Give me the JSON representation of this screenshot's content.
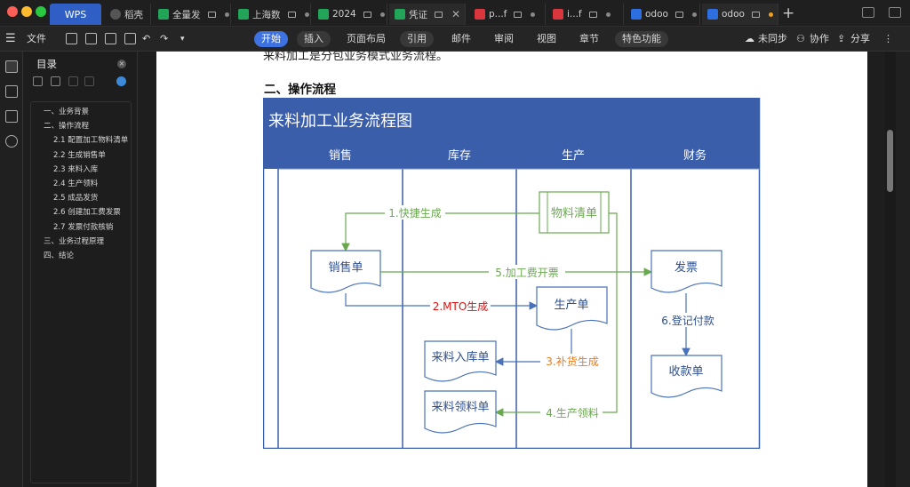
{
  "tabs": {
    "wps": "WPS",
    "items": [
      {
        "label": "稻壳",
        "icon": "docer-icon"
      },
      {
        "label": "全量发",
        "icon": "sheet-icon"
      },
      {
        "label": "上海数",
        "icon": "sheet-icon"
      },
      {
        "label": "2024",
        "icon": "sheet-icon"
      },
      {
        "label": "凭证",
        "icon": "sheet-icon"
      },
      {
        "label": "p...f",
        "icon": "pdf-icon"
      },
      {
        "label": "i...f",
        "icon": "pdf-icon"
      },
      {
        "label": "odoo",
        "icon": "writer-icon"
      },
      {
        "label": "odoo",
        "icon": "writer-icon"
      }
    ]
  },
  "toolbar": {
    "file_label": "文件",
    "menus": [
      "开始",
      "插入",
      "页面布局",
      "引用",
      "邮件",
      "审阅",
      "视图",
      "章节",
      "特色功能"
    ],
    "active_menu": "开始",
    "sync": "未同步",
    "collab": "协作",
    "share": "分享"
  },
  "toc": {
    "title": "目录",
    "items": [
      {
        "text": "一、业务背景",
        "level": 1
      },
      {
        "text": "二、操作流程",
        "level": 1
      },
      {
        "text": "2.1 配置加工物料清单",
        "level": 2
      },
      {
        "text": "2.2 生成销售单",
        "level": 2
      },
      {
        "text": "2.3 来料入库",
        "level": 2
      },
      {
        "text": "2.4 生产领料",
        "level": 2
      },
      {
        "text": "2.5 成品发货",
        "level": 2
      },
      {
        "text": "2.6 创建加工费发票",
        "level": 2
      },
      {
        "text": "2.7 发票付款核销",
        "level": 2
      },
      {
        "text": "三、业务过程原理",
        "level": 1
      },
      {
        "text": "四、结论",
        "level": 1
      }
    ]
  },
  "document": {
    "top_line": "来料加工是分包业务模式业务流程。",
    "heading": "二、操作流程"
  },
  "diagram": {
    "title": "来料加工业务流程图",
    "lanes": [
      "销售",
      "库存",
      "生产",
      "财务"
    ],
    "nodes": {
      "bom": "物料清单",
      "sales_order": "销售单",
      "invoice": "发票",
      "production_order": "生产单",
      "receipt_doc": "来料入库单",
      "picking_doc": "来料领料单",
      "payment_doc": "收款单"
    },
    "edges": {
      "e1": "1.快捷生成",
      "e2": "2.MTO生成",
      "e3": "3.补货生成",
      "e4": "4.生产领料",
      "e5": "5.加工费开票",
      "e6": "6.登记付款"
    },
    "colors": {
      "header": "#3b5eab",
      "node_border": "#4a72b8",
      "node_text": "#2f4f8f",
      "green": "#6aa84f",
      "red": "#e01010",
      "orange": "#e67e22",
      "blue": "#4a72b8"
    }
  }
}
